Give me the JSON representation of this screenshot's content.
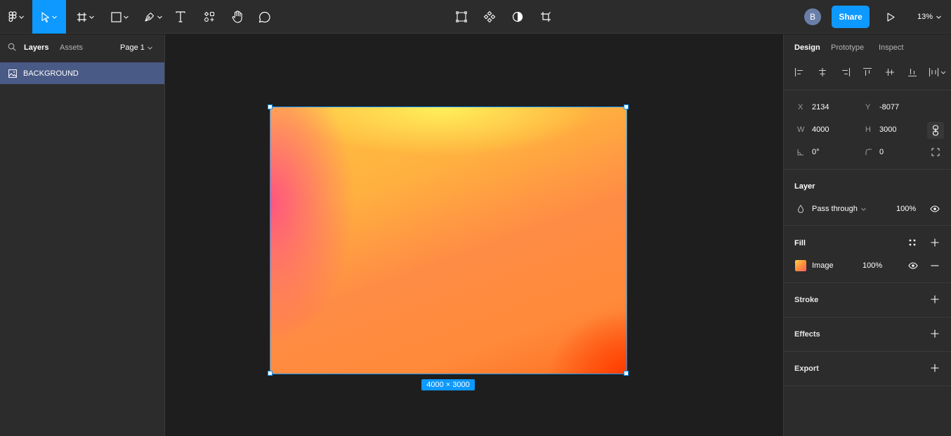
{
  "toolbar": {
    "tools": [
      "figma-menu",
      "move",
      "frame",
      "shape",
      "pen",
      "text",
      "resources",
      "hand",
      "comment"
    ],
    "center_tools": [
      "edit-object",
      "component",
      "mask",
      "crop"
    ],
    "avatar_initial": "B",
    "share_label": "Share",
    "zoom_label": "13%",
    "accent_color": "#0d99ff"
  },
  "left_panel": {
    "tabs": {
      "layers": "Layers",
      "assets": "Assets"
    },
    "page_selector": "Page 1",
    "layers": [
      {
        "name": "BACKGROUND",
        "icon": "image-layer-icon",
        "selected": true
      }
    ]
  },
  "canvas": {
    "selection_dimensions": "4000 × 3000",
    "selection_color": "#0d99ff"
  },
  "right_panel": {
    "tabs": {
      "design": "Design",
      "prototype": "Prototype",
      "inspect": "Inspect"
    },
    "position": {
      "x_label": "X",
      "x_value": "2134",
      "y_label": "Y",
      "y_value": "-8077",
      "w_label": "W",
      "w_value": "4000",
      "h_label": "H",
      "h_value": "3000",
      "rotation_value": "0°",
      "radius_value": "0"
    },
    "layer": {
      "title": "Layer",
      "blend_mode": "Pass through",
      "opacity": "100%"
    },
    "fill": {
      "title": "Fill",
      "type": "Image",
      "opacity": "100%"
    },
    "stroke": {
      "title": "Stroke"
    },
    "effects": {
      "title": "Effects"
    },
    "export": {
      "title": "Export"
    }
  }
}
